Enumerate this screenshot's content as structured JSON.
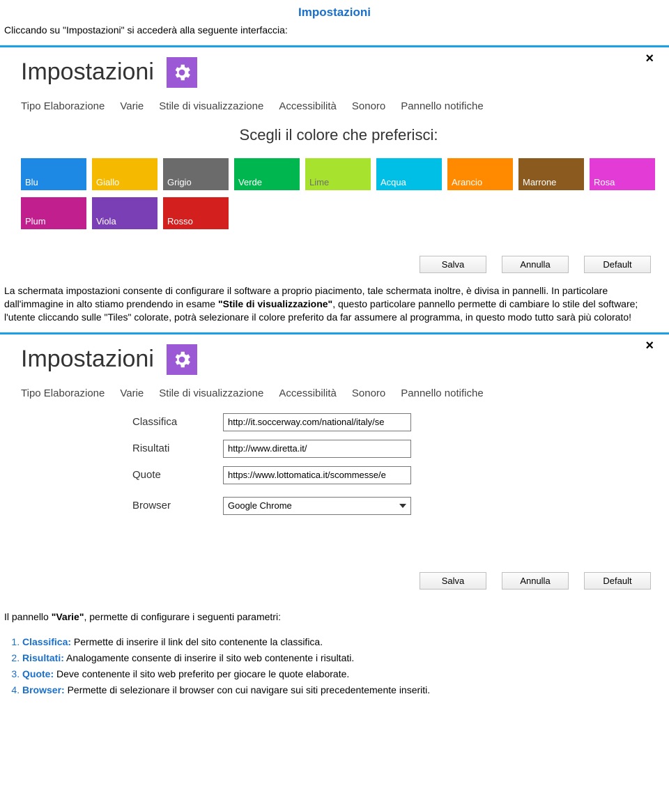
{
  "doc": {
    "title": "Impostazioni",
    "intro": "Cliccando su \"Impostazioni\" si accederà alla seguente interfaccia:",
    "mid": "La schermata impostazioni consente di configurare il software a proprio piacimento, tale schermata inoltre, è divisa in pannelli. In particolare dall'immagine in alto stiamo prendendo in esame \"Stile di visualizzazione\", questo particolare pannello permette di cambiare lo stile del software; l'utente cliccando sulle \"Tiles\" colorate, potrà selezionare il colore preferito da far assumere al programma, in questo modo tutto sarà più colorato!",
    "varie_intro": "Il pannello \"Varie\", permette di configurare i seguenti parametri:",
    "list": [
      {
        "key": "Classifica:",
        "body": " Permette di inserire il link del sito contenente la classifica."
      },
      {
        "key": "Risultati:",
        "body": " Analogamente consente di inserire il sito web contenente i risultati."
      },
      {
        "key": "Quote:",
        "body": " Deve contenente il sito web preferito per giocare le quote elaborate."
      },
      {
        "key": "Browser:",
        "body": " Permette di selezionare il browser con cui navigare sui siti precedentemente inseriti."
      }
    ]
  },
  "panel": {
    "title": "Impostazioni",
    "close": "×",
    "tabs": [
      "Tipo Elaborazione",
      "Varie",
      "Stile di visualizzazione",
      "Accessibilità",
      "Sonoro",
      "Pannello notifiche"
    ],
    "buttons": {
      "save": "Salva",
      "cancel": "Annulla",
      "default": "Default"
    }
  },
  "style_panel": {
    "subtitle": "Scegli il colore che preferisci:",
    "colors": [
      {
        "label": "Blu",
        "hex": "#1e88e5",
        "dark": false
      },
      {
        "label": "Giallo",
        "hex": "#f5b900",
        "dark": false
      },
      {
        "label": "Grigio",
        "hex": "#6b6b6b",
        "dark": false
      },
      {
        "label": "Verde",
        "hex": "#00b64f",
        "dark": false
      },
      {
        "label": "Lime",
        "hex": "#a6e22e",
        "dark": true
      },
      {
        "label": "Acqua",
        "hex": "#00bfe6",
        "dark": false
      },
      {
        "label": "Arancio",
        "hex": "#ff8a00",
        "dark": false
      },
      {
        "label": "Marrone",
        "hex": "#8a5a1f",
        "dark": false
      },
      {
        "label": "Rosa",
        "hex": "#e23bd6",
        "dark": false
      },
      {
        "label": "Plum",
        "hex": "#c21f8e",
        "dark": false
      },
      {
        "label": "Viola",
        "hex": "#7b3fb5",
        "dark": false
      },
      {
        "label": "Rosso",
        "hex": "#d41f1f",
        "dark": false
      }
    ]
  },
  "varie_panel": {
    "fields": {
      "classifica": {
        "label": "Classifica",
        "value": "http://it.soccerway.com/national/italy/se"
      },
      "risultati": {
        "label": "Risultati",
        "value": "http://www.diretta.it/"
      },
      "quote": {
        "label": "Quote",
        "value": "https://www.lottomatica.it/scommesse/e"
      },
      "browser": {
        "label": "Browser",
        "value": "Google Chrome"
      }
    }
  }
}
